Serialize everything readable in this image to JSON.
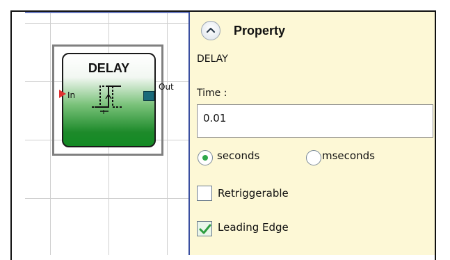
{
  "block": {
    "title": "DELAY",
    "input_label": "In",
    "output_label": "Out"
  },
  "property_panel": {
    "header": "Property",
    "block_name": "DELAY",
    "time_label": "Time :",
    "time_value": "0.01",
    "units": {
      "seconds_label": "seconds",
      "mseconds_label": "mseconds",
      "selected": "seconds"
    },
    "options": {
      "retriggerable_label": "Retriggerable",
      "retriggerable_checked": false,
      "leading_edge_label": "Leading Edge",
      "leading_edge_checked": true
    }
  },
  "colors": {
    "panel_bg": "#fdf8d6",
    "block_green": "#138a24",
    "input_pin": "#e03030",
    "output_pin": "#1a6b7a",
    "radio_selected": "#2fa84a",
    "check_mark": "#2e9e40"
  },
  "icons": {
    "collapse": "chevron-up-icon",
    "delay_symbol": "pulse-delay-icon",
    "check": "checkmark-icon"
  }
}
